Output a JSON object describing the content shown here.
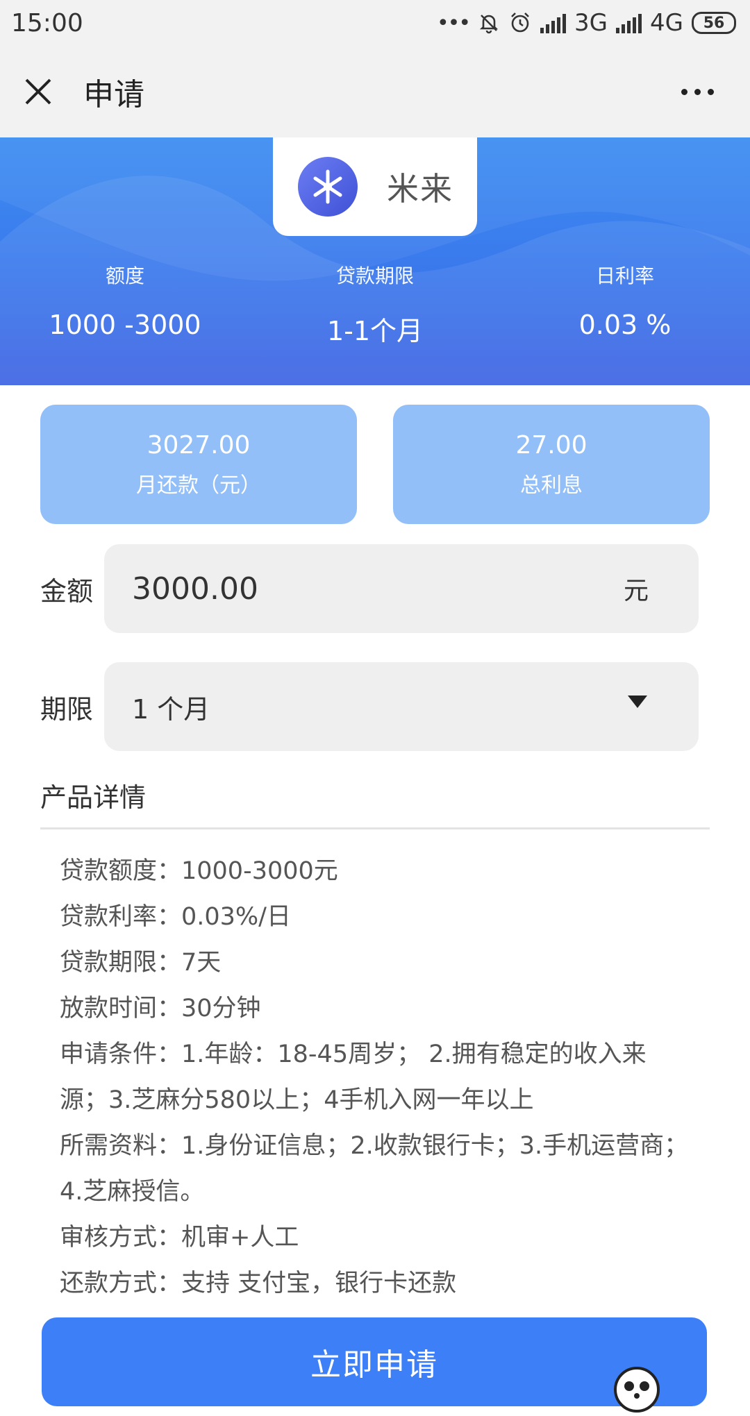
{
  "status_bar": {
    "time": "15:00",
    "network_1": "3G",
    "network_2": "4G",
    "battery": "56",
    "icons": [
      "more-dots-icon",
      "mute-bell-icon",
      "alarm-icon",
      "signal-icon",
      "signal-icon",
      "battery-icon"
    ]
  },
  "nav": {
    "title": "申请",
    "close_icon": "close-icon",
    "more_icon": "more-icon"
  },
  "hero": {
    "brand_name": "米来",
    "brand_logo": "wheat-logo-icon",
    "stats": [
      {
        "label": "额度",
        "value": "1000 -3000"
      },
      {
        "label": "贷款期限",
        "value": "1-1个月"
      },
      {
        "label": "日利率",
        "value": "0.03 %"
      }
    ]
  },
  "summary": [
    {
      "value": "3027.00",
      "label": "月还款（元）"
    },
    {
      "value": "27.00",
      "label": "总利息"
    }
  ],
  "form": {
    "amount_label": "金额",
    "amount_value": "3000.00",
    "amount_unit": "元",
    "term_label": "期限",
    "term_value": "1 个月"
  },
  "details": {
    "title": "产品详情",
    "lines": [
      "贷款额度：1000-3000元",
      "贷款利率：0.03%/日",
      "贷款期限：7天",
      "放款时间：30分钟",
      "申请条件：1.年龄：18-45周岁；  2.拥有稳定的收入来源；3.芝麻分580以上；4手机入网一年以上",
      "所需资料：1.身份证信息；2.收款银行卡；3.手机运营商；4.芝麻授信。",
      "审核方式：机审+人工",
      "还款方式：支持 支付宝，银行卡还款"
    ]
  },
  "apply_button": "立即申请",
  "colors": {
    "primary": "#3d7ff6",
    "hero_top": "#3d8ef2",
    "hero_bottom": "#3d63e3",
    "card": "#93bff8",
    "field_bg": "#efefef"
  }
}
